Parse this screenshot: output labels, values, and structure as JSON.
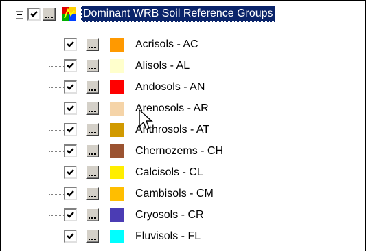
{
  "tree": {
    "group": {
      "label": "Dominant WRB Soil Reference Groups",
      "checked": true,
      "icon": "legend-icon"
    },
    "items": [
      {
        "label": "Acrisols - AC",
        "color": "#ff9900",
        "checked": true
      },
      {
        "label": "Alisols - AL",
        "color": "#ffffcc",
        "checked": true
      },
      {
        "label": "Andosols - AN",
        "color": "#ff0000",
        "checked": true
      },
      {
        "label": "Arenosols - AR",
        "color": "#f5d4a8",
        "checked": true
      },
      {
        "label": "Anthrosols - AT",
        "color": "#d19a00",
        "checked": true
      },
      {
        "label": "Chernozems - CH",
        "color": "#9b5331",
        "checked": true
      },
      {
        "label": "Calcisols - CL",
        "color": "#ffee00",
        "checked": true
      },
      {
        "label": "Cambisols - CM",
        "color": "#ffbe00",
        "checked": true
      },
      {
        "label": "Cryosols - CR",
        "color": "#4b3cb4",
        "checked": true
      },
      {
        "label": "Fluvisols - FL",
        "color": "#00ffff",
        "checked": true
      }
    ]
  },
  "colors": {
    "selection": "#0a246a",
    "button_face": "#d4d0c8"
  }
}
